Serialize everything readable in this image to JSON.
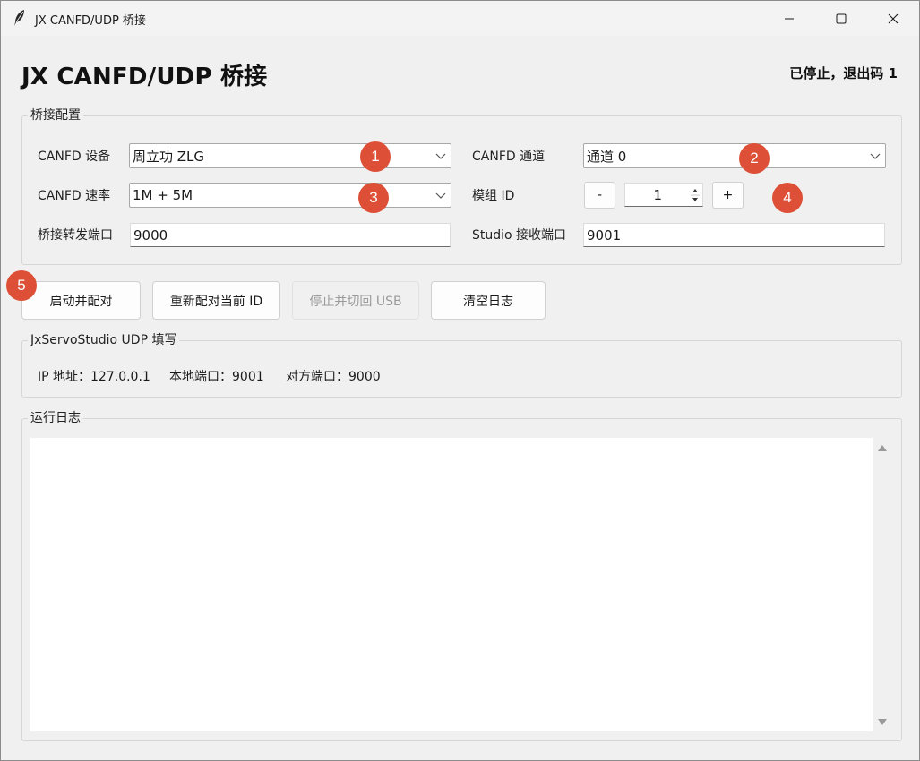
{
  "window": {
    "title": "JX CANFD/UDP 桥接"
  },
  "header": {
    "title": "JX CANFD/UDP 桥接",
    "status": "已停止，退出码 1"
  },
  "config": {
    "legend": "桥接配置",
    "device_label": "CANFD 设备",
    "device_value": "周立功 ZLG",
    "channel_label": "CANFD 通道",
    "channel_value": "通道 0",
    "rate_label": "CANFD 速率",
    "rate_value": "1M + 5M",
    "module_label": "模组 ID",
    "module_value": "1",
    "minus_label": "-",
    "plus_label": "+",
    "bridge_port_label": "桥接转发端口",
    "bridge_port_value": "9000",
    "studio_port_label": "Studio 接收端口",
    "studio_port_value": "9001"
  },
  "actions": {
    "start_label": "启动并配对",
    "repair_label": "重新配对当前 ID",
    "stop_label": "停止并切回 USB",
    "clear_label": "清空日志"
  },
  "udp": {
    "legend": "JxServoStudio UDP 填写",
    "ip": "IP 地址：127.0.0.1",
    "local_port": "本地端口：9001",
    "remote_port": "对方端口：9000"
  },
  "log": {
    "legend": "运行日志"
  },
  "badges": [
    "1",
    "2",
    "3",
    "4",
    "5"
  ],
  "colors": {
    "badge": "#dd4f36",
    "window_bg": "#f0f0f0"
  },
  "icons": {
    "app": "feather-icon",
    "minimize": "minimize-icon",
    "maximize": "maximize-icon",
    "close": "close-icon"
  }
}
